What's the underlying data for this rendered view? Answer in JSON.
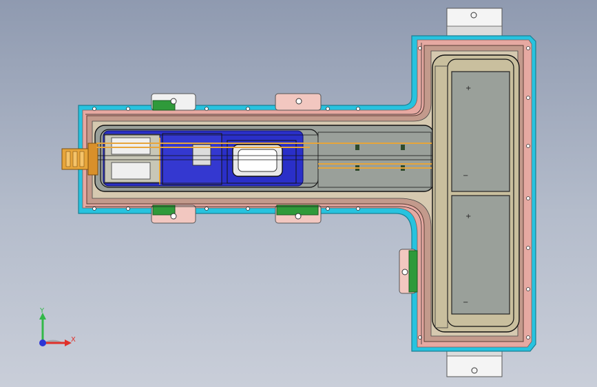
{
  "viewport": {
    "background_top": "#8f9ab0",
    "background_bottom": "#c9ced9"
  },
  "colors": {
    "frame_cyan": "#27c3df",
    "frame_pink": "#e6a9a2",
    "tray_brown": "#b98476",
    "module_gray": "#9aa09a",
    "module_blue": "#2a2fc8",
    "wire_orange": "#e7a53a",
    "bracket_green": "#2f9a3a",
    "bracket_white": "#f2f2f2"
  },
  "module_markings": {
    "plus_top": "+",
    "minus_top": "−",
    "plus_bottom": "+",
    "minus_bottom": "−"
  },
  "triad": {
    "y_label": "Y",
    "x_label": "X",
    "y_color": "#32b848",
    "x_color": "#e0302a",
    "z_color": "#2a35d6"
  }
}
